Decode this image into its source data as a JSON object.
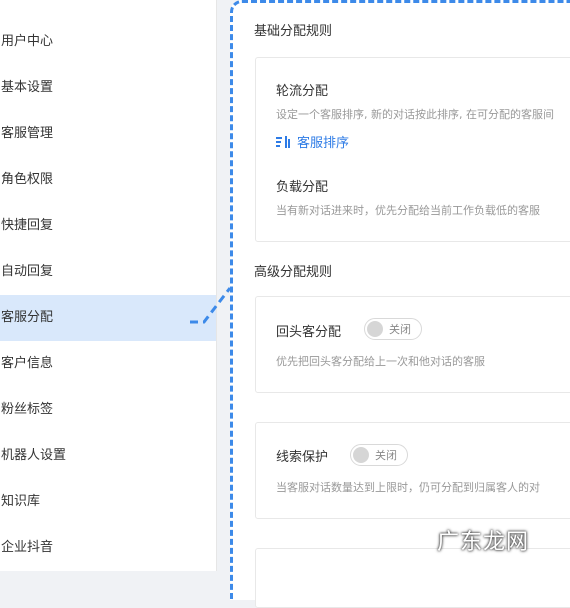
{
  "sidebar": {
    "items": [
      {
        "label": "用户中心"
      },
      {
        "label": "基本设置"
      },
      {
        "label": "客服管理"
      },
      {
        "label": "角色权限"
      },
      {
        "label": "快捷回复"
      },
      {
        "label": "自动回复"
      },
      {
        "label": "客服分配",
        "active": true
      },
      {
        "label": "客户信息"
      },
      {
        "label": "粉丝标签"
      },
      {
        "label": "机器人设置"
      },
      {
        "label": "知识库"
      },
      {
        "label": "企业抖音"
      }
    ]
  },
  "basic_rules": {
    "title": "基础分配规则",
    "round_robin": {
      "label": "轮流分配",
      "desc": "设定一个客服排序, 新的对话按此排序, 在可分配的客服间",
      "link_label": "客服排序",
      "link_icon": "sort-icon"
    },
    "load_balance": {
      "label": "负载分配",
      "desc": "当有新对话进来时，优先分配给当前工作负载低的客服"
    }
  },
  "advanced_rules": {
    "title": "高级分配规则",
    "returning_customer": {
      "label": "回头客分配",
      "toggle_label": "关闭",
      "desc": "优先把回头客分配给上一次和他对话的客服"
    },
    "lead_protection": {
      "label": "线索保护",
      "toggle_label": "关闭",
      "desc": "当客服对话数量达到上限时，仍可分配到归属客人的对"
    }
  },
  "watermark": {
    "text": "广东龙网"
  },
  "colors": {
    "accent": "#2d7be6",
    "active_bg": "#d9e8fb",
    "dash": "#3d8ae9"
  }
}
